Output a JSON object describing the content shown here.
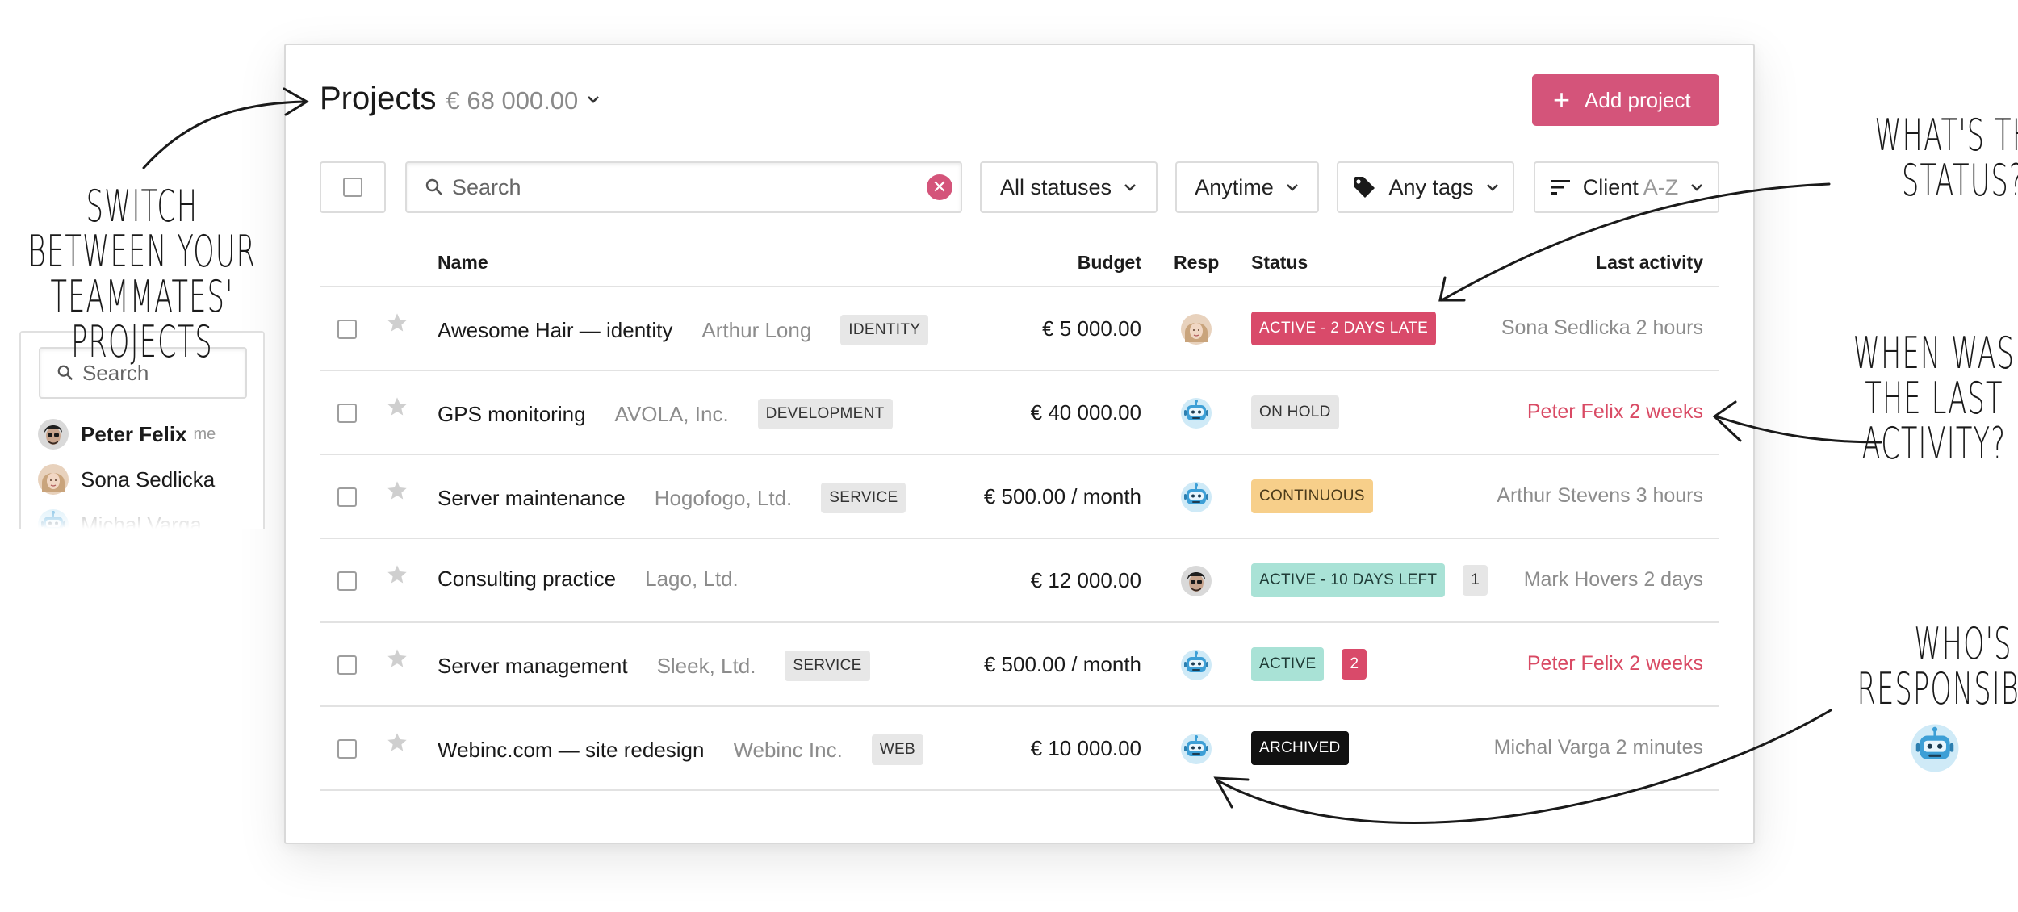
{
  "header": {
    "title": "Projects",
    "total": "€ 68 000.00",
    "add_label": "Add project"
  },
  "filters": {
    "search_placeholder": "Search",
    "status": "All statuses",
    "time": "Anytime",
    "tags": "Any tags",
    "sort": "Client",
    "sort_order": "A-Z"
  },
  "columns": {
    "name": "Name",
    "budget": "Budget",
    "resp": "Resp",
    "status": "Status",
    "activity": "Last activity"
  },
  "projects": [
    {
      "name": "Awesome Hair — identity",
      "client": "Arthur Long",
      "tag": "IDENTITY",
      "budget": "€ 5 000.00",
      "resp": "sona",
      "status": "ACTIVE - 2 DAYS LATE",
      "status_bg": "#d94a6a",
      "status_fg": "#ffffff",
      "count": "",
      "activity": "Sona Sedlicka 2 hours",
      "activity_hot": false
    },
    {
      "name": "GPS monitoring",
      "client": "AVOLA, Inc.",
      "tag": "DEVELOPMENT",
      "budget": "€ 40 000.00",
      "resp": "robot",
      "status": "ON HOLD",
      "status_bg": "#e6e6e6",
      "status_fg": "#333333",
      "count": "",
      "activity": "Peter Felix 2 weeks",
      "activity_hot": true
    },
    {
      "name": "Server maintenance",
      "client": "Hogofogo, Ltd.",
      "tag": "SERVICE",
      "budget": "€ 500.00 / month",
      "resp": "robot",
      "status": "CONTINUOUS",
      "status_bg": "#f7cf8a",
      "status_fg": "#4a3a1a",
      "count": "",
      "activity": "Arthur Stevens 3 hours",
      "activity_hot": false
    },
    {
      "name": "Consulting practice",
      "client": "Lago, Ltd.",
      "tag": "",
      "budget": "€ 12 000.00",
      "resp": "peter",
      "status": "ACTIVE - 10 DAYS LEFT",
      "status_bg": "#a9e2d6",
      "status_fg": "#1f3b36",
      "count": "1",
      "count_bg": "#e6e6e6",
      "count_fg": "#333333",
      "activity": "Mark Hovers 2 days",
      "activity_hot": false
    },
    {
      "name": "Server management",
      "client": "Sleek, Ltd.",
      "tag": "SERVICE",
      "budget": "€ 500.00 / month",
      "resp": "robot",
      "status": "ACTIVE",
      "status_bg": "#a9e2d6",
      "status_fg": "#1f3b36",
      "count": "2",
      "count_bg": "#d94a6a",
      "count_fg": "#ffffff",
      "activity": "Peter Felix 2 weeks",
      "activity_hot": true
    },
    {
      "name": "Webinc.com — site redesign",
      "client": "Webinc Inc.",
      "tag": "WEB",
      "budget": "€ 10 000.00",
      "resp": "robot",
      "status": "ARCHIVED",
      "status_bg": "#111111",
      "status_fg": "#ffffff",
      "count": "",
      "activity": "Michal Varga 2 minutes",
      "activity_hot": false
    }
  ],
  "switcher": {
    "search_placeholder": "Search",
    "mates": [
      {
        "name": "Peter Felix",
        "me": "me",
        "avatar": "peter"
      },
      {
        "name": "Sona Sedlicka",
        "me": "",
        "avatar": "sona"
      },
      {
        "name": "Michal Varga",
        "me": "",
        "avatar": "robot"
      }
    ]
  },
  "annotations": {
    "switch": "Switch between your teammates' projects",
    "status": "What's the status?",
    "activity": "When was the last activity?",
    "responsible": "Who's responsible?"
  },
  "colors": {
    "accent": "#d4547a",
    "hot_text": "#d94a64"
  }
}
